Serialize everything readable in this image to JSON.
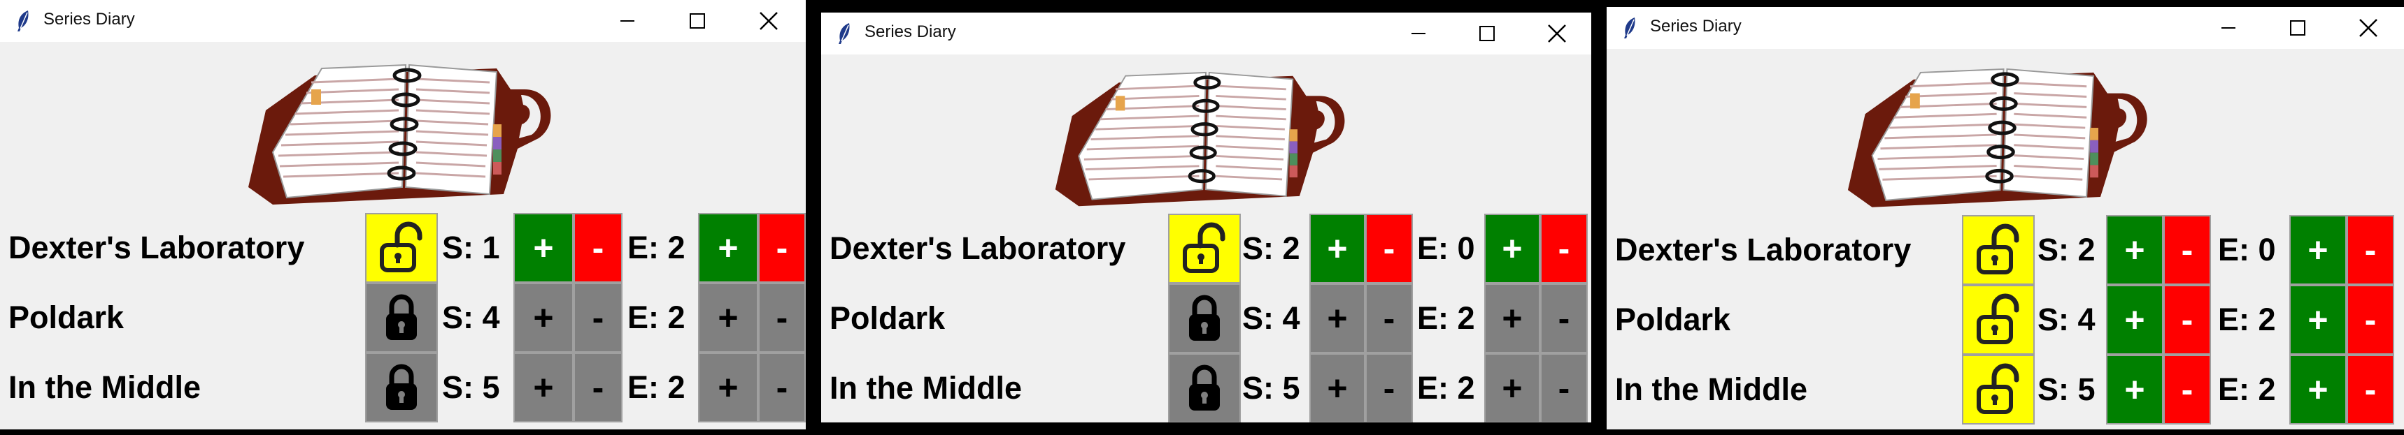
{
  "windows": [
    {
      "title": "Series Diary",
      "rows": [
        {
          "name": "Dexter's Laboratory",
          "lock": "unlocked",
          "season_label": "S: 1",
          "episode_label": "E: 2",
          "active": true
        },
        {
          "name": "Poldark",
          "lock": "locked",
          "season_label": "S: 4",
          "episode_label": "E: 2",
          "active": false
        },
        {
          "name": "In the Middle",
          "lock": "locked",
          "season_label": "S: 5",
          "episode_label": "E: 2",
          "active": false
        }
      ]
    },
    {
      "title": "Series Diary",
      "rows": [
        {
          "name": "Dexter's Laboratory",
          "lock": "unlocked",
          "season_label": "S: 2",
          "episode_label": "E: 0",
          "active": true
        },
        {
          "name": "Poldark",
          "lock": "locked",
          "season_label": "S: 4",
          "episode_label": "E: 2",
          "active": false
        },
        {
          "name": "In the Middle",
          "lock": "locked",
          "season_label": "S: 5",
          "episode_label": "E: 2",
          "active": false
        }
      ]
    },
    {
      "title": "Series Diary",
      "rows": [
        {
          "name": "Dexter's Laboratory",
          "lock": "unlocked",
          "season_label": "S: 2",
          "episode_label": "E: 0",
          "active": true
        },
        {
          "name": "Poldark",
          "lock": "unlocked",
          "season_label": "S: 4",
          "episode_label": "E: 2",
          "active": true
        },
        {
          "name": "In the Middle",
          "lock": "unlocked",
          "season_label": "S: 5",
          "episode_label": "E: 2",
          "active": true
        }
      ]
    }
  ],
  "labels": {
    "plus": "+",
    "minus": "-"
  },
  "icons": {
    "app": "feather-icon",
    "minimize": "minimize-icon",
    "maximize": "maximize-icon",
    "close": "close-icon",
    "diary": "diary-organizer-image",
    "unlocked": "unlocked-padlock-icon",
    "locked": "locked-padlock-icon"
  },
  "colors": {
    "unlocked_bg": "#ffff00",
    "locked_bg": "#808080",
    "increment_bg": "#008000",
    "decrement_bg": "#ff0000",
    "disabled_bg": "#808080",
    "window_bg": "#f0f0f0"
  }
}
